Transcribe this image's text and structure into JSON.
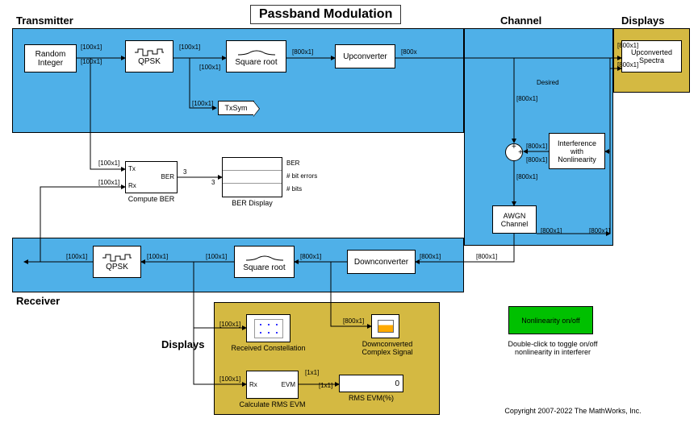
{
  "title": "Passband Modulation",
  "sections": {
    "transmitter": "Transmitter",
    "channel": "Channel",
    "displays": "Displays",
    "receiver": "Receiver",
    "displays2": "Displays"
  },
  "blocks": {
    "random_integer": "Random\nInteger",
    "qpsk_tx": "QPSK",
    "square_root_tx": "Square root",
    "upconverter": "Upconverter",
    "txsym": "TxSym",
    "compute_ber": "Compute BER",
    "ber_display": "BER Display",
    "ber_port": "BER",
    "tx_port": "Tx",
    "rx_port": "Rx",
    "ber_row1": "BER",
    "ber_row2": "# bit errors",
    "ber_row3": "# bits",
    "upconv_spectra": "Upconverted Spectra",
    "interference": "Interference\nwith\nNonlinearity",
    "awgn": "AWGN\nChannel",
    "desired": "Desired",
    "qpsk_rx": "QPSK",
    "square_root_rx": "Square root",
    "downconverter": "Downconverter",
    "received_const": "Received Constellation",
    "downconv_signal": "Downconverted\nComplex Signal",
    "calc_evm": "Calculate RMS EVM",
    "rms_evm_disp": "RMS EVM(%)",
    "rms_value": "0",
    "evm_port": "EVM",
    "rx_port2": "Rx",
    "nonlin_btn": "Nonlinearity on/off",
    "nonlin_text": "Double-click to toggle on/off\nnonlinearity in interferer",
    "copyright": "Copyright 2007-2022 The MathWorks, Inc."
  },
  "signals": {
    "s100": "[100x1]",
    "s800": "[800x1]",
    "s800b": "[800x",
    "s1": "[1x1]",
    "n3": "3"
  }
}
